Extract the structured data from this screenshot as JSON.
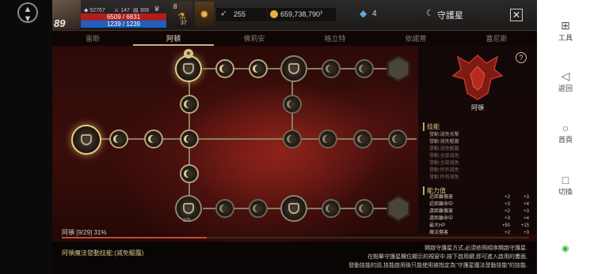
{
  "system_left": {
    "menu_icon": "chevron-up-down-icon"
  },
  "hud": {
    "level": "89",
    "stat_a": "52767",
    "stat_b": "147",
    "stat_c": "306",
    "hp": "6509 / 6831",
    "mp": "1239 / 1239",
    "item_count": "8",
    "item_count2": "37",
    "silver": "255",
    "gold": "659,738,790",
    "crystal": "4",
    "panel_title": "守護星"
  },
  "tabs": [
    "雷斯",
    "阿頓",
    "佛莉安",
    "格立特",
    "依諾蒂",
    "蓋尼斯"
  ],
  "active_tab": 1,
  "right_panel": {
    "emblem_name": "阿頓",
    "help_icon": "?",
    "skills_title": "技能",
    "skills": [
      "發動:減免攻擊",
      "發動:減免驅籠",
      "發動:減免驅籠",
      "發動:全部減免",
      "發動:全部減免",
      "發動:所有減免",
      "發動:所有減免"
    ],
    "stats_title": "能力值",
    "stats": [
      {
        "name": "近距離傷害",
        "a": "+2",
        "b": "+3"
      },
      {
        "name": "近距離命中",
        "a": "+3",
        "b": "+4"
      },
      {
        "name": "遠距離傷害",
        "a": "+2",
        "b": "+3"
      },
      {
        "name": "遠距離命中",
        "a": "+3",
        "b": "+4"
      },
      {
        "name": "最大HP",
        "a": "+50",
        "b": "+15"
      },
      {
        "name": "魔法傷害",
        "a": "+2",
        "b": "+3"
      }
    ]
  },
  "node_counter": "3/5",
  "progress": {
    "label": "阿頓 [9/29] 31%",
    "fraction": 0.31
  },
  "bottom": {
    "skill_label": "阿頓魔法發動技能:(減免驅籠)",
    "instructions": [
      "開啟守護星方式,必須依照順序開啟守護星.",
      "在點擊守護星欄位顯示的視窗中,按下啟用鍵,即可進入啟用的畫面.",
      "發動技能的話,技能啟用後只能使用被指定為\"守護星魔法發動技能\"的技能."
    ]
  },
  "system_right": {
    "tools": "工具",
    "back": "返回",
    "home": "首頁",
    "switch": "切換"
  }
}
